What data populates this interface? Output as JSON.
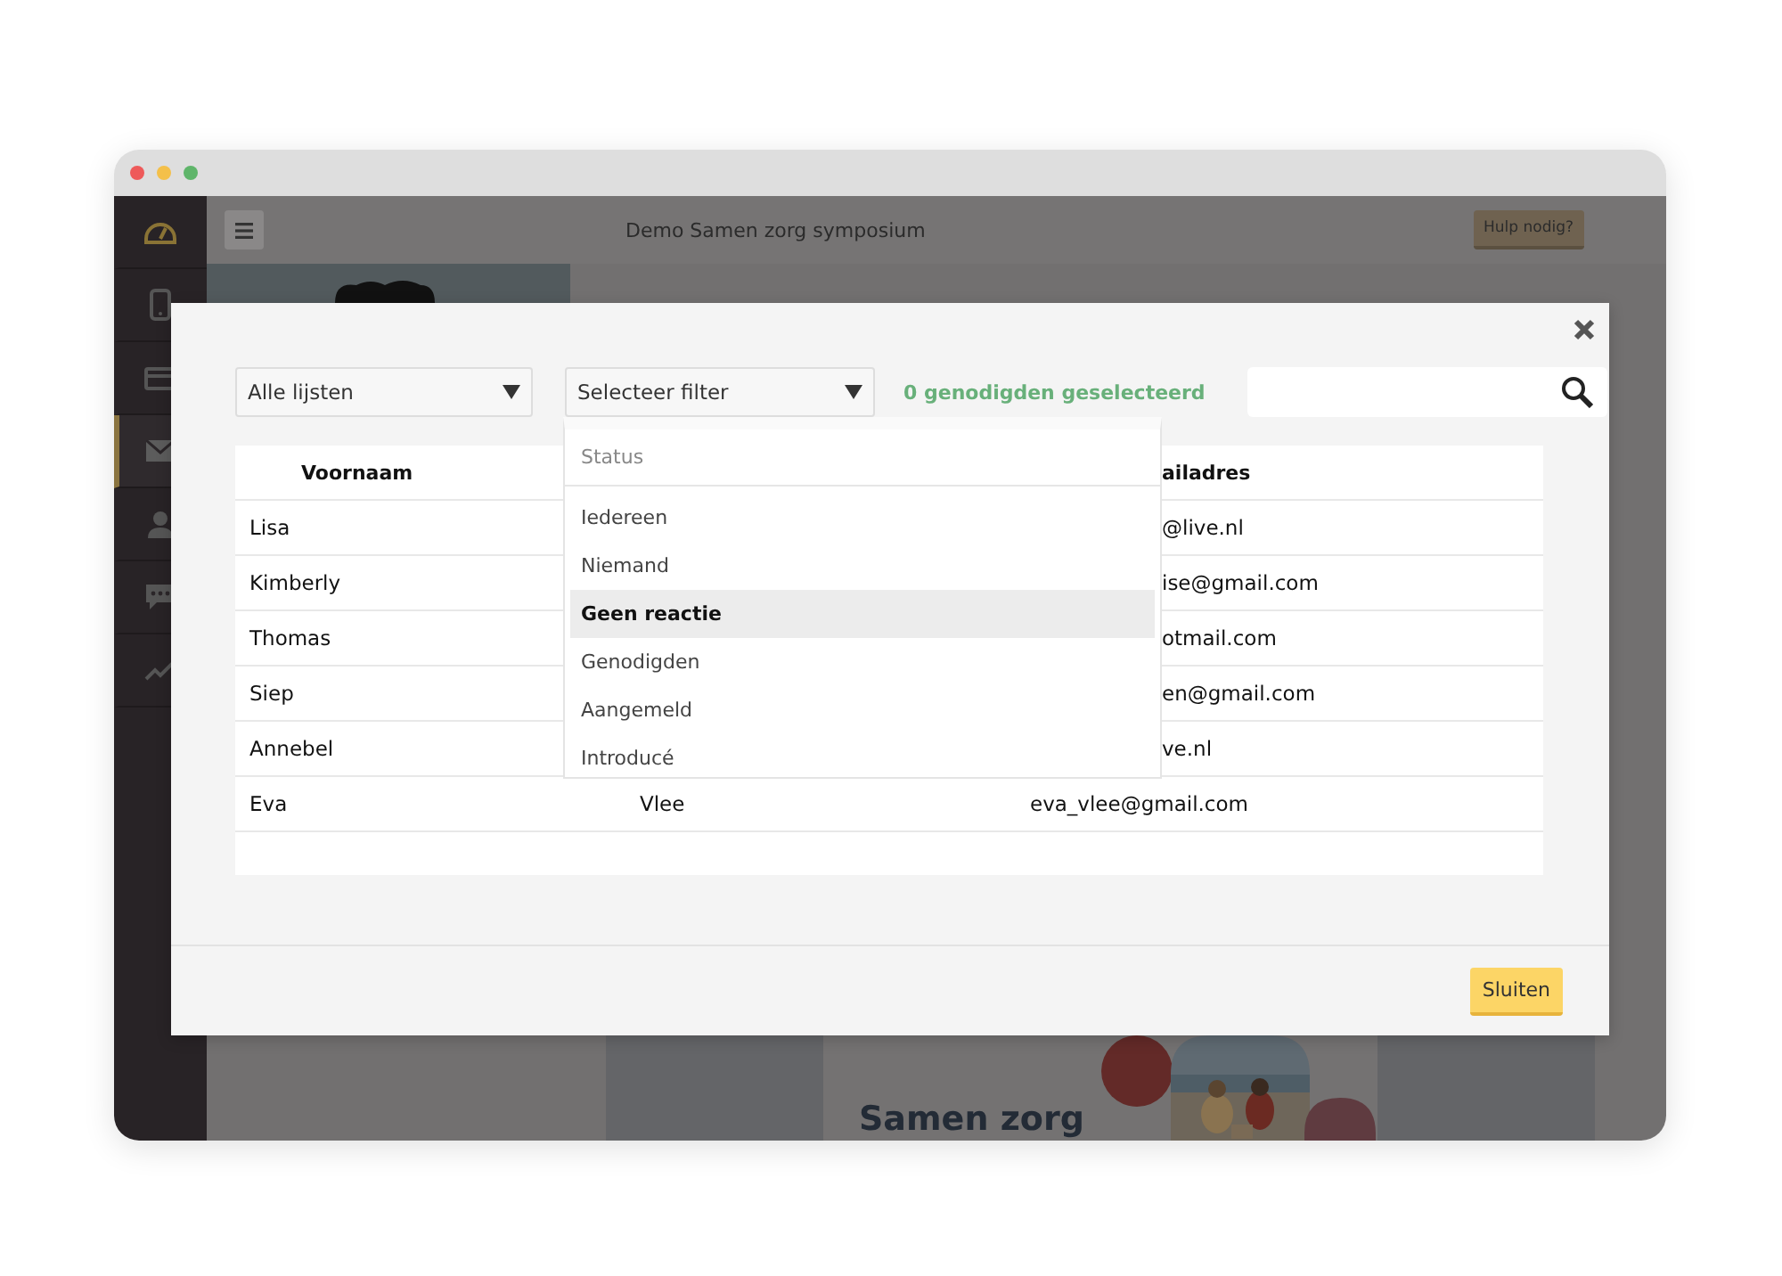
{
  "app": {
    "title": "Demo Samen zorg symposium",
    "help_button": "Hulp nodig?"
  },
  "sidebar": {
    "items": [
      {
        "kind": "gauge",
        "selected": false
      },
      {
        "kind": "phone",
        "selected": false
      },
      {
        "kind": "card",
        "selected": false
      },
      {
        "kind": "mail",
        "selected": true
      },
      {
        "kind": "person",
        "selected": false
      },
      {
        "kind": "chat",
        "selected": false
      },
      {
        "kind": "chart",
        "selected": false
      }
    ]
  },
  "background": {
    "poster_title": "Samen zorg"
  },
  "modal": {
    "list_select": "Alle lijsten",
    "filter_select": "Selecteer filter",
    "selection_count": "0 genodigden geselecteerd",
    "filter_menu": {
      "group": "Status",
      "options": [
        {
          "label": "Iedereen",
          "selected": false
        },
        {
          "label": "Niemand",
          "selected": false
        },
        {
          "label": "Geen reactie",
          "selected": true
        },
        {
          "label": "Genodigden",
          "selected": false
        },
        {
          "label": "Aangemeld",
          "selected": false
        },
        {
          "label": "Introducé",
          "selected": false
        }
      ]
    },
    "table": {
      "headers": {
        "first_name": "Voornaam",
        "column_3": "ailadres"
      },
      "rows": [
        {
          "first_name": "Lisa",
          "email": "@live.nl"
        },
        {
          "first_name": "Kimberly",
          "email": "ise@gmail.com"
        },
        {
          "first_name": "Thomas",
          "email": "otmail.com"
        },
        {
          "first_name": "Siep",
          "email": "en@gmail.com"
        },
        {
          "first_name": "Annebel",
          "email": "ve.nl"
        },
        {
          "first_name": "Eva",
          "last_name": "Vlee",
          "email": "eva_vlee@gmail.com"
        }
      ]
    },
    "close_button": "Sluiten"
  }
}
